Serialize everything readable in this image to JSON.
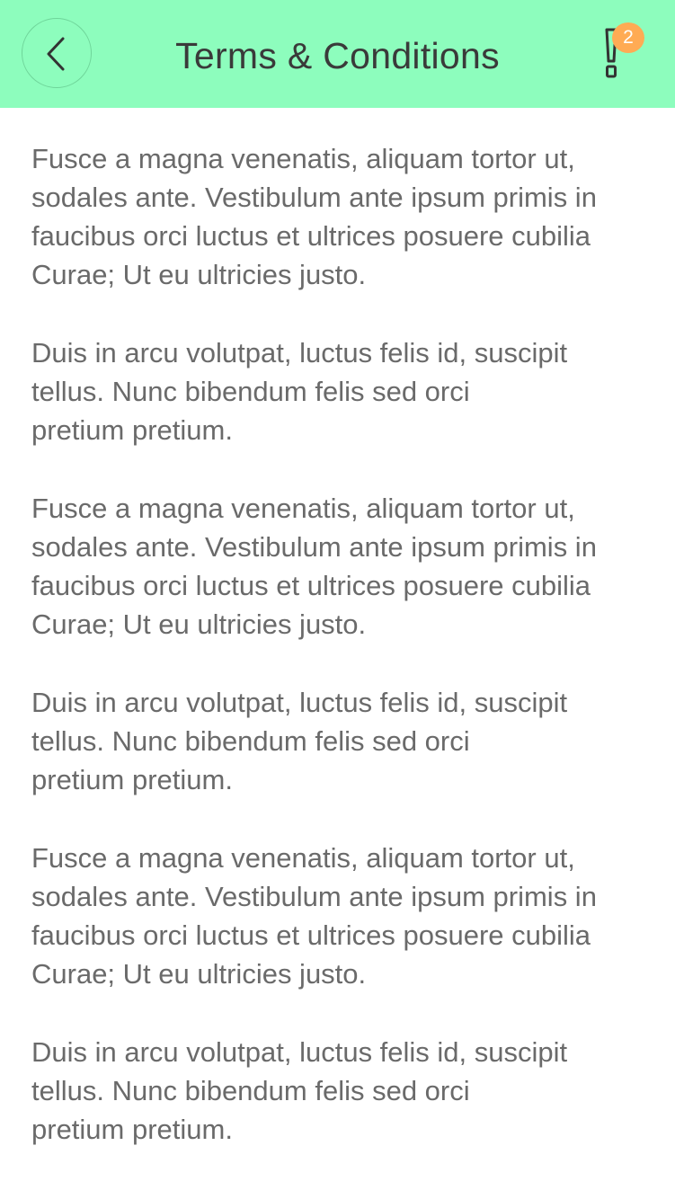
{
  "header": {
    "title": "Terms & Conditions",
    "badge_count": "2",
    "accent_color": "#8dfdbd",
    "badge_color": "#ffab54",
    "back_icon": "chevron-left-icon",
    "alert_icon": "exclamation-icon"
  },
  "paragraphs": [
    "Fusce a magna venenatis, aliquam tortor ut,\nsodales ante. Vestibulum ante ipsum primis in\nfaucibus orci luctus et ultrices posuere cubilia\nCurae; Ut eu ultricies justo.",
    "Duis in arcu volutpat, luctus felis id, suscipit\ntellus. Nunc bibendum felis sed orci\npretium pretium.",
    "Fusce a magna venenatis, aliquam tortor ut,\nsodales ante. Vestibulum ante ipsum primis in\nfaucibus orci luctus et ultrices posuere cubilia\nCurae; Ut eu ultricies justo.",
    "Duis in arcu volutpat, luctus felis id, suscipit\ntellus. Nunc bibendum felis sed orci\npretium pretium.",
    "Fusce a magna venenatis, aliquam tortor ut,\nsodales ante. Vestibulum ante ipsum primis in\nfaucibus orci luctus et ultrices posuere cubilia\nCurae; Ut eu ultricies justo.",
    "Duis in arcu volutpat, luctus felis id, suscipit\ntellus. Nunc bibendum felis sed orci\npretium pretium."
  ]
}
